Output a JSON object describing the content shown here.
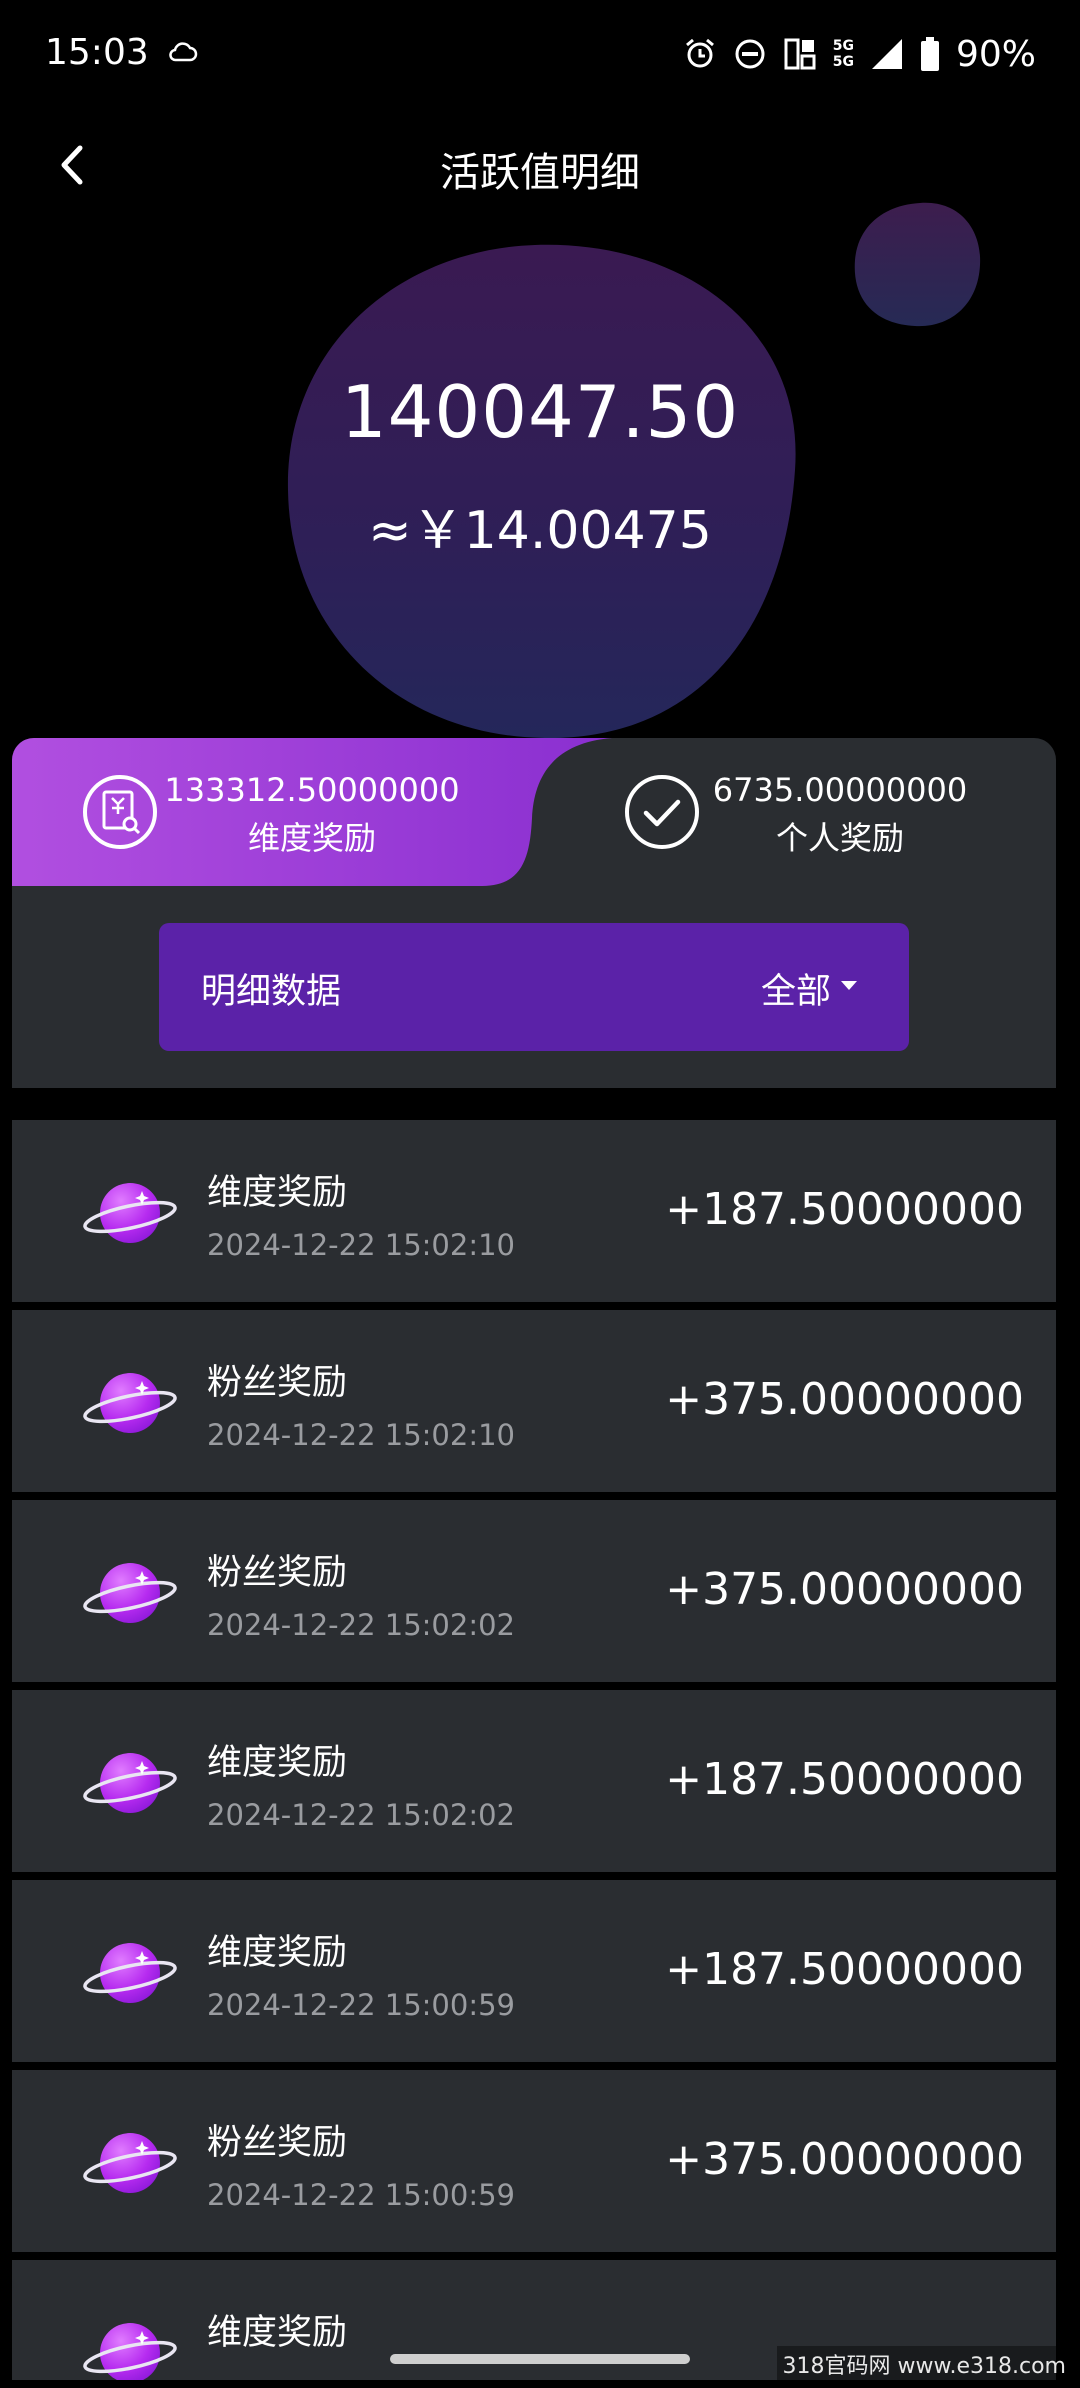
{
  "status_bar": {
    "time": "15:03",
    "battery": "90%",
    "net_top": "5G",
    "net_bottom": "5G"
  },
  "header": {
    "title": "活跃值明细"
  },
  "summary": {
    "total": "140047.50",
    "approx_cny": "≈￥14.00475"
  },
  "tabs": [
    {
      "value": "133312.50000000",
      "label": "维度奖励",
      "icon": "receipt-search-icon",
      "active": true
    },
    {
      "value": "6735.00000000",
      "label": "个人奖励",
      "icon": "check-circle-icon",
      "active": false
    }
  ],
  "filter": {
    "label": "明细数据",
    "value": "全部"
  },
  "records": [
    {
      "name": "维度奖励",
      "time": "2024-12-22 15:02:10",
      "amount": "+187.50000000"
    },
    {
      "name": "粉丝奖励",
      "time": "2024-12-22 15:02:10",
      "amount": "+375.00000000"
    },
    {
      "name": "粉丝奖励",
      "time": "2024-12-22 15:02:02",
      "amount": "+375.00000000"
    },
    {
      "name": "维度奖励",
      "time": "2024-12-22 15:02:02",
      "amount": "+187.50000000"
    },
    {
      "name": "维度奖励",
      "time": "2024-12-22 15:00:59",
      "amount": "+187.50000000"
    },
    {
      "name": "粉丝奖励",
      "time": "2024-12-22 15:00:59",
      "amount": "+375.00000000"
    },
    {
      "name": "维度奖励",
      "time": "",
      "amount": ""
    }
  ],
  "watermark": "318官码网 www.e318.com",
  "colors": {
    "accent_purple": "#5b22a8",
    "tab_gradient_start": "#b14fe0",
    "tab_gradient_end": "#8a2fd0",
    "card_bg": "#2a2d31"
  }
}
